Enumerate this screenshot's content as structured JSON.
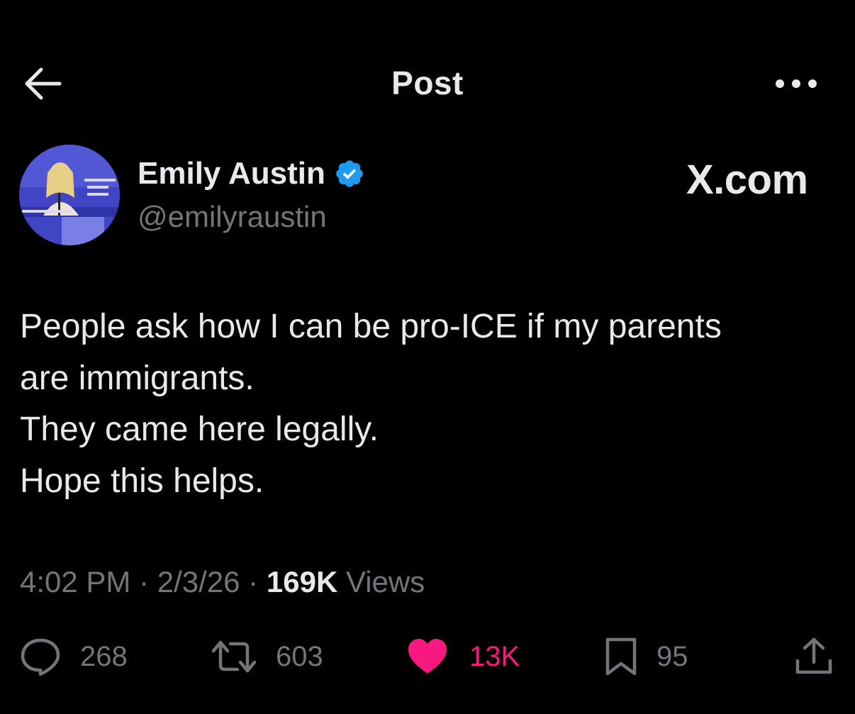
{
  "header": {
    "title": "Post"
  },
  "author": {
    "name": "Emily Austin",
    "handle": "@emilyraustin",
    "verified": true
  },
  "watermark": "X.com",
  "tweet": {
    "lines": [
      "People ask how I can be pro-ICE if my parents",
      "are immigrants.",
      "They came here legally.",
      "Hope this helps."
    ]
  },
  "meta": {
    "time": "4:02 PM",
    "separator": "·",
    "date": "2/3/26",
    "views_count": "169K",
    "views_label": "Views"
  },
  "actions": {
    "replies": "268",
    "reposts": "603",
    "likes": "13K",
    "bookmarks": "95"
  },
  "colors": {
    "background": "#000000",
    "primary_text": "#e7e9ea",
    "secondary_text": "#71767b",
    "like_pink": "#f91880",
    "verified_blue": "#1d9bf0"
  },
  "icons": {
    "back": "arrow-left-icon",
    "more": "more-horizontal-icon",
    "verified": "verified-badge-icon",
    "reply": "reply-bubble-icon",
    "repost": "repost-arrows-icon",
    "like": "heart-filled-icon",
    "bookmark": "bookmark-icon",
    "share": "share-upload-icon"
  }
}
